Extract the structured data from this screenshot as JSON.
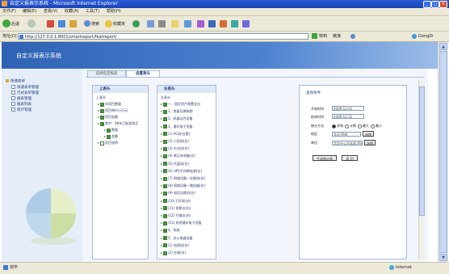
{
  "window": {
    "title": "自定义报表示系统 - Microsoft Internet Explorer"
  },
  "menu": [
    "文件(F)",
    "编辑(E)",
    "查看(V)",
    "收藏(A)",
    "工具(T)",
    "帮助(H)"
  ],
  "toolbar": {
    "back": "后退",
    "search": "搜索",
    "favorites": "收藏夹"
  },
  "address": {
    "label": "地址(D)",
    "url": "http://127.0.0.1:8001/smartreport/featreport/",
    "go": "转到",
    "links": "链接",
    "dict": "DongDi"
  },
  "banner": {
    "title": "自定义报表示系统"
  },
  "tree": {
    "root": "快速表单",
    "items": [
      "快速表单管理",
      "行式表单管理",
      "报表管理",
      "报表列表",
      "统计管理"
    ]
  },
  "tabs": [
    {
      "label": "选择指定报表",
      "active": false
    },
    {
      "label": "设置表头",
      "active": true
    }
  ],
  "upper_header": {
    "title": "上表头",
    "subtitle": "上表头",
    "items": [
      {
        "label": "年项目数量",
        "checked": true,
        "level": 0
      },
      {
        "label": "项目单价(元/元)",
        "checked": true,
        "level": 0
      },
      {
        "label": "项目金额",
        "checked": true,
        "level": 0
      },
      {
        "label": "其中：08年已批准购买",
        "checked": true,
        "level": 0
      },
      {
        "label": "数量",
        "checked": true,
        "level": 1
      },
      {
        "label": "金额",
        "checked": true,
        "level": 1
      },
      {
        "label": "项目说明",
        "checked": false,
        "level": 0
      }
    ]
  },
  "left_header": {
    "title": "左表头",
    "subtitle": "左表头",
    "items": [
      "一、固定资产购置支出",
      "1、房屋及建筑物",
      "2、机器动力设备",
      "3、通讯电子设备",
      "(1) PC机(台套)",
      "(2) 小型机(台)",
      "(3) 台式机(台)",
      "(4) 笔记本电脑(台)",
      "(5) 托盘站(台)",
      "(6) UPS不间断电源(台)",
      "(7) 网络设备一交换机(台)",
      "(8) 网络设备一路由器(台)",
      "(9) 电话交换机(台)",
      "(10) 打印机(台)",
      "(11) 投影仪(台)",
      "(12) 扫描仪(台)",
      "(13) 其他通讯电子设备",
      "4、系统",
      "5、办公电器设备",
      "(1) 电视机(台)",
      "(2) 空调(台)"
    ]
  },
  "conditions": {
    "title": "查询条件",
    "start_label": "开始时间",
    "start_value": "2009-12-01",
    "end_label": "结束时间",
    "end_value": "2009-12-31",
    "method_label": "统计方法",
    "methods": [
      {
        "label": "求和",
        "selected": true
      },
      {
        "label": "计数",
        "selected": false
      },
      {
        "label": "最大",
        "selected": false
      },
      {
        "label": "最小",
        "selected": false
      }
    ],
    "region_label": "地区：",
    "region_value": "华北,西南",
    "region_select": "选择",
    "unit_label": "单位：",
    "unit_value": "华北分公司本部,西南分公司",
    "unit_select": "选择",
    "generate": "生成统计表",
    "back": "返 回"
  },
  "status": {
    "left": "完毕",
    "zone": "Internet"
  },
  "colors": {
    "banner": "#2f62b4",
    "title_bar": "#2a5bd7",
    "panel": "#e4edf8",
    "check": "#3a9a3a"
  }
}
